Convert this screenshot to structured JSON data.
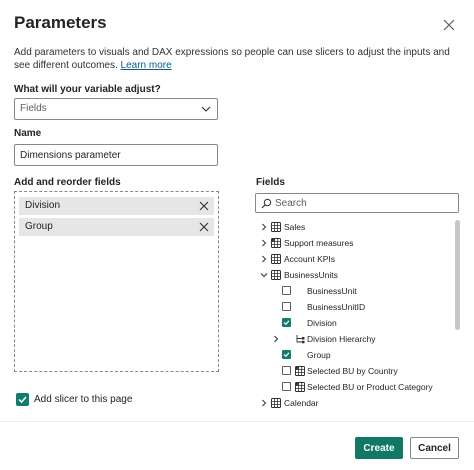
{
  "dialog": {
    "title": "Parameters",
    "description": "Add parameters to visuals and DAX expressions so people can use slicers to adjust the inputs and see different outcomes.",
    "learn_more": "Learn more"
  },
  "variable": {
    "label": "What will your variable adjust?",
    "selected": "Fields"
  },
  "name": {
    "label": "Name",
    "value": "Dimensions parameter"
  },
  "reorder": {
    "label": "Add and reorder fields",
    "items": [
      "Division",
      "Group"
    ]
  },
  "slicer": {
    "label": "Add slicer to this page",
    "checked": true
  },
  "fields": {
    "label": "Fields",
    "search_placeholder": "Search",
    "tree": [
      {
        "label": "Sales",
        "icon": "table-icon",
        "level": 0,
        "expandable": true,
        "expanded": false
      },
      {
        "label": "Support measures",
        "icon": "calc-table-icon",
        "level": 0,
        "expandable": true,
        "expanded": false
      },
      {
        "label": "Account KPIs",
        "icon": "table-icon",
        "level": 0,
        "expandable": true,
        "expanded": false
      },
      {
        "label": "BusinessUnits",
        "icon": "table-icon",
        "level": 0,
        "expandable": true,
        "expanded": true
      },
      {
        "label": "BusinessUnit",
        "level": 1,
        "checkbox": true,
        "checked": false
      },
      {
        "label": "BusinessUnitID",
        "level": 1,
        "checkbox": true,
        "checked": false
      },
      {
        "label": "Division",
        "level": 1,
        "checkbox": true,
        "checked": true
      },
      {
        "label": "Division Hierarchy",
        "icon": "hierarchy-icon",
        "level": 1,
        "expandable": true,
        "expanded": false
      },
      {
        "label": "Group",
        "level": 1,
        "checkbox": true,
        "checked": true
      },
      {
        "label": "Selected BU by Country",
        "icon": "calc-table-icon",
        "level": 1,
        "checkbox": true,
        "checked": false
      },
      {
        "label": "Selected BU or Product Category",
        "icon": "calc-table-icon",
        "level": 1,
        "checkbox": true,
        "checked": false
      },
      {
        "label": "Calendar",
        "icon": "table-icon",
        "level": 0,
        "expandable": true,
        "expanded": false
      }
    ]
  },
  "buttons": {
    "create": "Create",
    "cancel": "Cancel"
  },
  "colors": {
    "accent": "#117865",
    "link": "#0b5a8f"
  }
}
